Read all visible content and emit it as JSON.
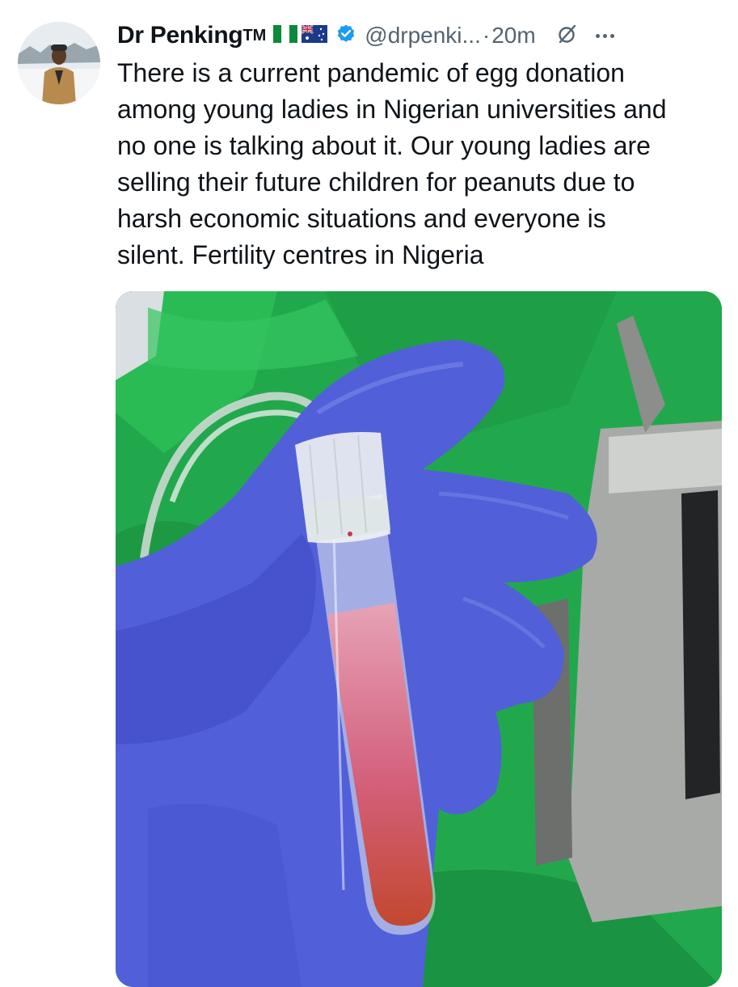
{
  "author": {
    "display_name": "Dr Penking",
    "tm": "TM",
    "handle": "@drpenki...",
    "separator": "·",
    "time": "20m"
  },
  "icons": {
    "flag_1": "nigeria-flag-icon",
    "flag_2": "australia-flag-icon",
    "verified": "verified-badge-icon",
    "grok": "grok-icon",
    "more": "more-options-icon"
  },
  "colors": {
    "verified": "#1d9bf0",
    "muted_text": "#536471",
    "body_text": "#0f1419"
  },
  "tweet": {
    "text": "There is a current pandemic of egg donation\namong young ladies in Nigerian universities and\nno one is talking about it. Our young ladies are\nselling their future children for peanuts due to\nharsh economic situations and everyone is\nsilent. Fertility centres in Nigeria"
  }
}
